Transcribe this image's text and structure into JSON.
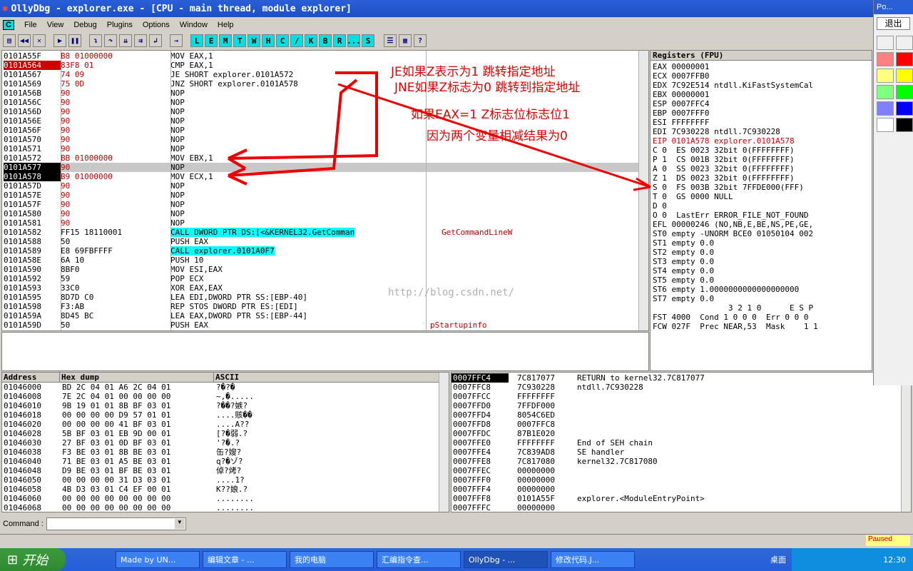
{
  "window": {
    "title": "OllyDbg - explorer.exe - [CPU - main thread, module explorer]"
  },
  "menu": [
    "File",
    "View",
    "Debug",
    "Plugins",
    "Options",
    "Window",
    "Help"
  ],
  "toolbar_letters": [
    "L",
    "E",
    "M",
    "T",
    "W",
    "H",
    "C",
    "/",
    "K",
    "B",
    "R",
    "...",
    "S"
  ],
  "disasm": [
    {
      "a": "0101A55F",
      "h": "B8 01000000",
      "i": "MOV EAX,1",
      "c": ""
    },
    {
      "a": "0101A564",
      "h": "83F8 01",
      "i": "CMP EAX,1",
      "c": ""
    },
    {
      "a": "0101A567",
      "h": "74 09",
      "i": "JE SHORT explorer.0101A572",
      "c": ""
    },
    {
      "a": "0101A569",
      "h": "75 0D",
      "i": "JNZ SHORT explorer.0101A578",
      "c": ""
    },
    {
      "a": "0101A56B",
      "h": "90",
      "i": "NOP",
      "c": ""
    },
    {
      "a": "0101A56C",
      "h": "90",
      "i": "NOP",
      "c": ""
    },
    {
      "a": "0101A56D",
      "h": "90",
      "i": "NOP",
      "c": ""
    },
    {
      "a": "0101A56E",
      "h": "90",
      "i": "NOP",
      "c": ""
    },
    {
      "a": "0101A56F",
      "h": "90",
      "i": "NOP",
      "c": ""
    },
    {
      "a": "0101A570",
      "h": "90",
      "i": "NOP",
      "c": ""
    },
    {
      "a": "0101A571",
      "h": "90",
      "i": "NOP",
      "c": ""
    },
    {
      "a": "0101A572",
      "h": "BB 01000000",
      "i": "MOV EBX,1",
      "c": ""
    },
    {
      "a": "0101A577",
      "h": "90",
      "i": "NOP",
      "c": ""
    },
    {
      "a": "0101A578",
      "h": "B9 01000000",
      "i": "MOV ECX,1",
      "c": ""
    },
    {
      "a": "0101A57D",
      "h": "90",
      "i": "NOP",
      "c": ""
    },
    {
      "a": "0101A57E",
      "h": "90",
      "i": "NOP",
      "c": ""
    },
    {
      "a": "0101A57F",
      "h": "90",
      "i": "NOP",
      "c": ""
    },
    {
      "a": "0101A580",
      "h": "90",
      "i": "NOP",
      "c": ""
    },
    {
      "a": "0101A581",
      "h": "90",
      "i": "NOP",
      "c": ""
    },
    {
      "a": "0101A582",
      "h": "FF15 18110001",
      "i": "CALL DWORD PTR DS:[<&KERNEL32.GetComman",
      "c": "GetCommandLineW"
    },
    {
      "a": "0101A588",
      "h": "50",
      "i": "PUSH EAX",
      "c": ""
    },
    {
      "a": "0101A589",
      "h": "E8 69FBFFFF",
      "i": "CALL explorer.0101A0F7",
      "c": ""
    },
    {
      "a": "0101A58E",
      "h": "6A 10",
      "i": "PUSH 10",
      "c": ""
    },
    {
      "a": "0101A590",
      "h": "8BF0",
      "i": "MOV ESI,EAX",
      "c": ""
    },
    {
      "a": "0101A592",
      "h": "59",
      "i": "POP ECX",
      "c": ""
    },
    {
      "a": "0101A593",
      "h": "33C0",
      "i": "XOR EAX,EAX",
      "c": ""
    },
    {
      "a": "0101A595",
      "h": "8D7D C0",
      "i": "LEA EDI,DWORD PTR SS:[EBP-40]",
      "c": ""
    },
    {
      "a": "0101A598",
      "h": "F3:AB",
      "i": "REP STOS DWORD PTR ES:[EDI]",
      "c": ""
    },
    {
      "a": "0101A59A",
      "h": "8D45 BC",
      "i": "LEA EAX,DWORD PTR SS:[EBP-44]",
      "c": ""
    },
    {
      "a": "0101A59D",
      "h": "50",
      "i": "PUSH EAX",
      "c": "pStartupinfo"
    }
  ],
  "registers_title": "Registers (FPU)",
  "registers": [
    "EAX 00000001",
    "ECX 0007FFB0",
    "EDX 7C92E514 ntdll.KiFastSystemCal",
    "EBX 00000001",
    "ESP 0007FFC4",
    "EBP 0007FFF0",
    "ESI FFFFFFFF",
    "EDI 7C930228 ntdll.7C930228",
    "",
    "EIP 0101A578 explorer.0101A578",
    "",
    "C 0  ES 0023 32bit 0(FFFFFFFF)",
    "P 1  CS 001B 32bit 0(FFFFFFFF)",
    "A 0  SS 0023 32bit 0(FFFFFFFF)",
    "Z 1  DS 0023 32bit 0(FFFFFFFF)",
    "S 0  FS 003B 32bit 7FFDE000(FFF)",
    "T 0  GS 0000 NULL",
    "D 0",
    "O 0  LastErr ERROR_FILE_NOT_FOUND",
    "",
    "EFL 00000246 (NO,NB,E,BE,NS,PE,GE,",
    "",
    "ST0 empty -UNORM BCE0 01050104 002",
    "ST1 empty 0.0",
    "ST2 empty 0.0",
    "ST3 empty 0.0",
    "ST4 empty 0.0",
    "ST5 empty 0.0",
    "ST6 empty 1.0000000000000000000",
    "ST7 empty 0.0",
    "                3 2 1 0      E S P",
    "FST 4000  Cond 1 0 0 0  Err 0 0 0",
    "FCW 027F  Prec NEAR,53  Mask    1 1"
  ],
  "dump_headers": [
    "Address",
    "Hex dump",
    "ASCII"
  ],
  "dump": [
    {
      "a": "01046000",
      "h": "BD 2C 04 01 A6 2C 04 01",
      "s": "?�?�"
    },
    {
      "a": "01046008",
      "h": "7E 2C 04 01 00 00 00 00",
      "s": "~,�....."
    },
    {
      "a": "01046010",
      "h": "9B 19 01 01 8B BF 03 01",
      "s": "?��?嫉?"
    },
    {
      "a": "01046018",
      "h": "00 00 00 00 D9 57 01 01",
      "s": "....賅��"
    },
    {
      "a": "01046020",
      "h": "00 00 00 00 41 BF 03 01",
      "s": "....A??"
    },
    {
      "a": "01046028",
      "h": "5B BF 03 01 EB 9D 00 01",
      "s": "[?�弱.?"
    },
    {
      "a": "01046030",
      "h": "27 BF 03 01 0D BF 03 01",
      "s": "'?�.?"
    },
    {
      "a": "01046038",
      "h": "F3 BE 03 01 8B BE 03 01",
      "s": "缶?嫂?"
    },
    {
      "a": "01046040",
      "h": "71 BE 03 01 A5 BE 03 01",
      "s": "q?�ゾ?"
    },
    {
      "a": "01046048",
      "h": "D9 BE 03 01 BF BE 03 01",
      "s": "倬?烤?"
    },
    {
      "a": "01046050",
      "h": "00 00 00 00 31 D3 03 01",
      "s": "....1?"
    },
    {
      "a": "01046058",
      "h": "4B D3 03 01 C4 EF 00 01",
      "s": "K??娘.?"
    },
    {
      "a": "01046060",
      "h": "00 00 00 00 00 00 00 00",
      "s": "........"
    },
    {
      "a": "01046068",
      "h": "00 00 00 00 00 00 00 00",
      "s": "........"
    }
  ],
  "stack": [
    {
      "a": "0007FFC4",
      "v": "7C817077",
      "c": "RETURN to kernel32.7C817077"
    },
    {
      "a": "0007FFC8",
      "v": "7C930228",
      "c": "ntdll.7C930228"
    },
    {
      "a": "0007FFCC",
      "v": "FFFFFFFF",
      "c": ""
    },
    {
      "a": "0007FFD0",
      "v": "7FFDF000",
      "c": ""
    },
    {
      "a": "0007FFD4",
      "v": "8054C6ED",
      "c": ""
    },
    {
      "a": "0007FFD8",
      "v": "0007FFC8",
      "c": ""
    },
    {
      "a": "0007FFDC",
      "v": "87B1E020",
      "c": ""
    },
    {
      "a": "0007FFE0",
      "v": "FFFFFFFF",
      "c": "End of SEH chain"
    },
    {
      "a": "0007FFE4",
      "v": "7C839AD8",
      "c": "SE handler"
    },
    {
      "a": "0007FFE8",
      "v": "7C817080",
      "c": "kernel32.7C817080"
    },
    {
      "a": "0007FFEC",
      "v": "00000000",
      "c": ""
    },
    {
      "a": "0007FFF0",
      "v": "00000000",
      "c": ""
    },
    {
      "a": "0007FFF4",
      "v": "00000000",
      "c": ""
    },
    {
      "a": "0007FFF8",
      "v": "0101A55F",
      "c": "explorer.<ModuleEntryPoint>"
    },
    {
      "a": "0007FFFC",
      "v": "00000000",
      "c": ""
    }
  ],
  "annotations": [
    "JE如果Z表示为1 跳转指定地址",
    "JNE如果Z标志为0 跳转到指定地址",
    "如果EAX=1 Z标志位标志位1",
    "因为两个变量相减结果为0"
  ],
  "watermark": "http://blog.csdn.net/",
  "command_label": "Command :",
  "status": "Paused",
  "palette": {
    "title": "Po...",
    "exit": "退出"
  },
  "taskbar": {
    "start": "开始",
    "tasks": [
      "Made by UN...",
      "编辑文章 - ...",
      "我的电脑",
      "汇编指令查...",
      "OllyDbg - ...",
      "修改代码.J..."
    ],
    "desktop": "桌面",
    "clock": "12:30"
  }
}
